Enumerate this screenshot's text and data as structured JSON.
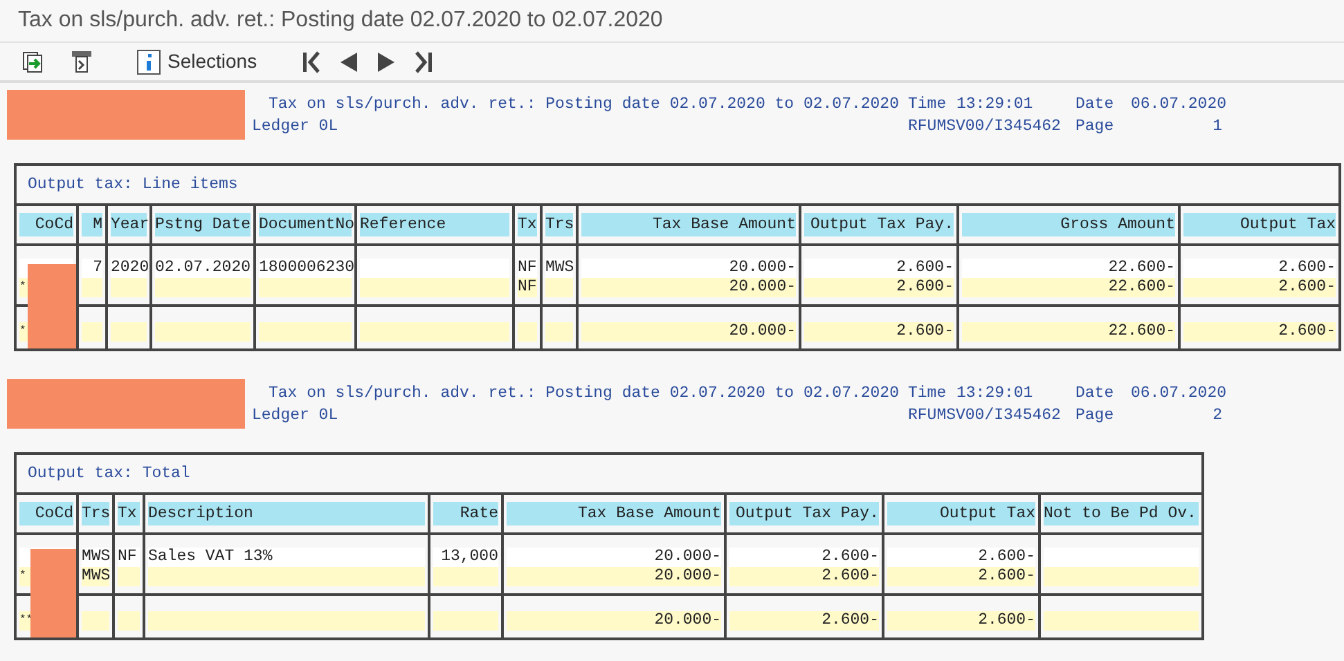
{
  "window": {
    "title": "Tax on sls/purch. adv. ret.: Posting date 02.07.2020 to 02.07.2020"
  },
  "toolbar": {
    "selections_label": "Selections"
  },
  "pages": [
    {
      "header": {
        "redacted": true,
        "title": "Tax on sls/purch. adv. ret.: Posting date 02.07.2020 to 02.07.2020",
        "ledger": "Ledger 0L",
        "time_label": "Time",
        "time": "13:29:01",
        "date_label": "Date",
        "date": "06.07.2020",
        "program": "RFUMSV00/I345462",
        "page_label": "Page",
        "page": "1"
      },
      "table": {
        "title": "Output tax: Line items",
        "redacted": true,
        "columns": [
          "CoCd",
          "M",
          "Year",
          "Pstng Date",
          "DocumentNo",
          "Reference",
          "Tx",
          "Trs",
          "Tax Base Amount",
          "Output Tax Pay.",
          "Gross Amount",
          "Output Tax"
        ],
        "groups": [
          {
            "lines": [
              {
                "kind": "item",
                "cells": [
                  null,
                  "7",
                  "2020",
                  "02.07.2020",
                  "1800006230",
                  null,
                  "NF",
                  "MWS",
                  "20.000-",
                  "2.600-",
                  "22.600-",
                  "2.600-"
                ]
              },
              {
                "kind": "sum",
                "cells": [
                  "*",
                  null,
                  null,
                  null,
                  null,
                  null,
                  "NF",
                  null,
                  "20.000-",
                  "2.600-",
                  "22.600-",
                  "2.600-"
                ]
              }
            ]
          },
          {
            "lines": [
              {
                "kind": "sum",
                "cells": [
                  "*",
                  null,
                  null,
                  null,
                  null,
                  null,
                  null,
                  null,
                  "20.000-",
                  "2.600-",
                  "22.600-",
                  "2.600-"
                ]
              }
            ]
          }
        ]
      }
    },
    {
      "header": {
        "redacted": true,
        "title": "Tax on sls/purch. adv. ret.: Posting date 02.07.2020 to 02.07.2020",
        "ledger": "Ledger 0L",
        "time_label": "Time",
        "time": "13:29:01",
        "date_label": "Date",
        "date": "06.07.2020",
        "program": "RFUMSV00/I345462",
        "page_label": "Page",
        "page": "2"
      },
      "table": {
        "title": "Output tax: Total",
        "redacted": true,
        "columns": [
          "CoCd",
          "Trs",
          "Tx",
          "Description",
          "Rate",
          "Tax Base Amount",
          "Output Tax Pay.",
          "Output Tax",
          "Not to Be Pd Ov."
        ],
        "groups": [
          {
            "lines": [
              {
                "kind": "item",
                "cells": [
                  null,
                  "MWS",
                  "NF",
                  "Sales VAT 13%",
                  "13,000",
                  "20.000-",
                  "2.600-",
                  "2.600-",
                  null
                ]
              },
              {
                "kind": "sum",
                "cells": [
                  "*",
                  "MWS",
                  null,
                  null,
                  null,
                  "20.000-",
                  "2.600-",
                  "2.600-",
                  null
                ]
              }
            ]
          },
          {
            "lines": [
              {
                "kind": "sum",
                "cells": [
                  "**",
                  null,
                  null,
                  null,
                  null,
                  "20.000-",
                  "2.600-",
                  "2.600-",
                  null
                ]
              }
            ]
          }
        ]
      }
    }
  ]
}
